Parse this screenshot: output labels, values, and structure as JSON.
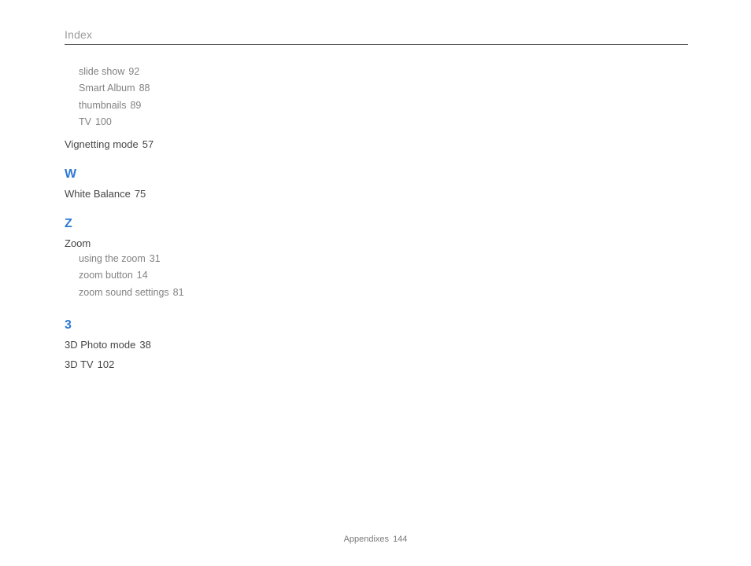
{
  "header": "Index",
  "initial_subs": [
    {
      "label": "slide show",
      "page": "92"
    },
    {
      "label": "Smart Album",
      "page": "88"
    },
    {
      "label": "thumbnails",
      "page": "89"
    },
    {
      "label": "TV",
      "page": "100"
    }
  ],
  "entry_vignetting": {
    "label": "Vignetting mode",
    "page": "57"
  },
  "letter_w": "W",
  "entry_white_balance": {
    "label": "White Balance",
    "page": "75"
  },
  "letter_z": "Z",
  "entry_zoom": {
    "label": "Zoom"
  },
  "zoom_subs": [
    {
      "label": "using the zoom",
      "page": "31"
    },
    {
      "label": "zoom button",
      "page": "14"
    },
    {
      "label": "zoom sound settings",
      "page": "81"
    }
  ],
  "letter_3": "3",
  "entry_3d_photo": {
    "label": "3D Photo mode",
    "page": "38"
  },
  "entry_3d_tv": {
    "label": "3D TV",
    "page": "102"
  },
  "footer": {
    "label": "Appendixes",
    "page": "144"
  }
}
